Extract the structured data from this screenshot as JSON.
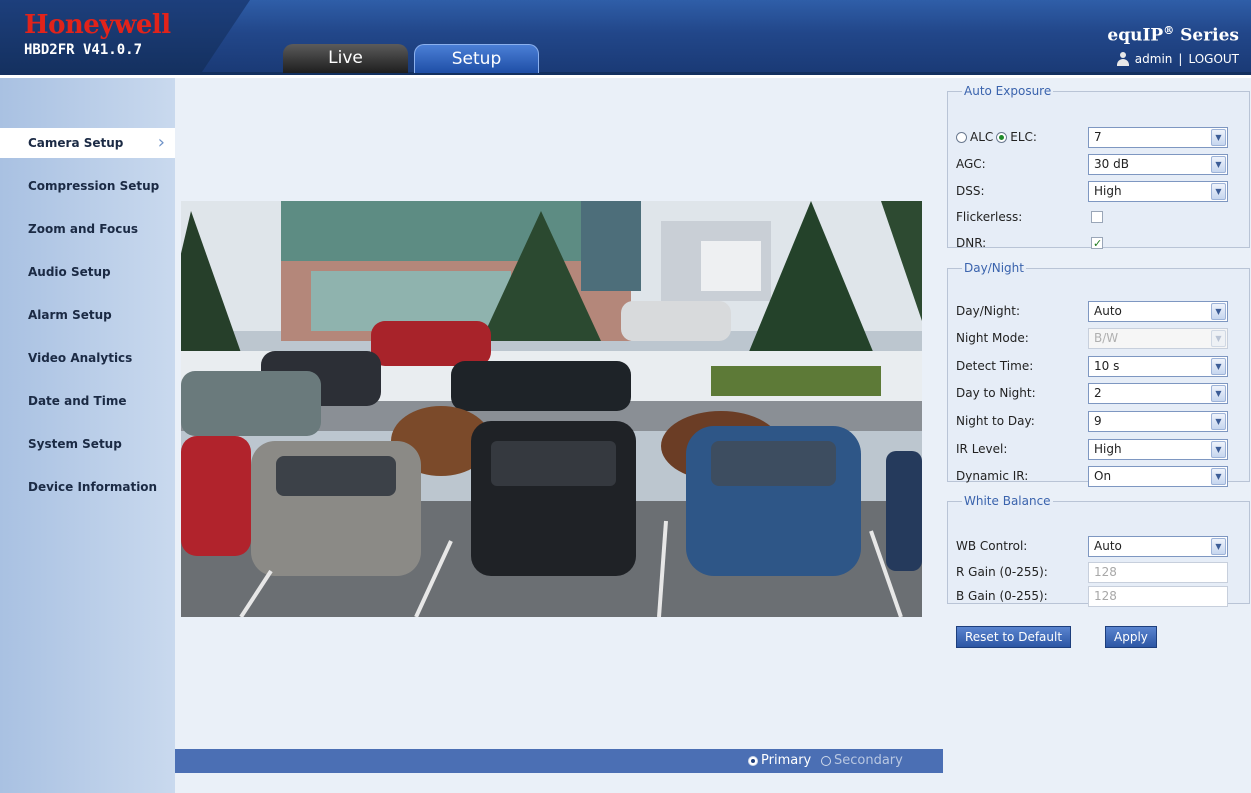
{
  "header": {
    "brand": "Honeywell",
    "firmware": "HBD2FR V41.0.7",
    "series": "equIP",
    "series_sup": "®",
    "series_suffix": " Series",
    "user": "admin",
    "separator": "|",
    "logout": "LOGOUT",
    "tabs": [
      {
        "label": "Live",
        "active": false
      },
      {
        "label": "Setup",
        "active": true
      }
    ]
  },
  "sidebar": {
    "items": [
      {
        "label": "Camera Setup",
        "active": true
      },
      {
        "label": "Compression Setup"
      },
      {
        "label": "Zoom and Focus"
      },
      {
        "label": "Audio Setup"
      },
      {
        "label": "Alarm Setup"
      },
      {
        "label": "Video Analytics"
      },
      {
        "label": "Date and Time"
      },
      {
        "label": "System Setup"
      },
      {
        "label": "Device Information"
      }
    ]
  },
  "stream": {
    "primary": "Primary",
    "secondary": "Secondary",
    "selected": "Primary"
  },
  "auto_exposure": {
    "title": "Auto Exposure",
    "alc_label": "ALC",
    "elc_label": "ELC:",
    "mode": "ELC",
    "elc_value": "7",
    "agc_label": "AGC:",
    "agc_value": "30 dB",
    "dss_label": "DSS:",
    "dss_value": "High",
    "flickerless_label": "Flickerless:",
    "flickerless_checked": false,
    "dnr_label": "DNR:",
    "dnr_checked": true
  },
  "day_night": {
    "title": "Day/Night",
    "day_night_label": "Day/Night:",
    "day_night_value": "Auto",
    "night_mode_label": "Night Mode:",
    "night_mode_value": "B/W",
    "detect_time_label": "Detect Time:",
    "detect_time_value": "10 s",
    "day_to_night_label": "Day to Night:",
    "day_to_night_value": "2",
    "night_to_day_label": "Night to Day:",
    "night_to_day_value": "9",
    "ir_level_label": "IR Level:",
    "ir_level_value": "High",
    "dynamic_ir_label": "Dynamic IR:",
    "dynamic_ir_value": "On"
  },
  "white_balance": {
    "title": "White Balance",
    "wb_control_label": "WB Control:",
    "wb_control_value": "Auto",
    "r_gain_label": "R Gain (0-255):",
    "r_gain_value": "128",
    "b_gain_label": "B Gain (0-255):",
    "b_gain_value": "128"
  },
  "buttons": {
    "reset": "Reset to Default",
    "apply": "Apply"
  },
  "icons": {
    "user": "user-icon",
    "chevron": "chevron-right-icon",
    "dropdown": "dropdown-arrow-icon"
  },
  "colors": {
    "brand_red": "#e2231a",
    "header_blue": "#22478a",
    "accent_blue": "#3a63ad"
  }
}
